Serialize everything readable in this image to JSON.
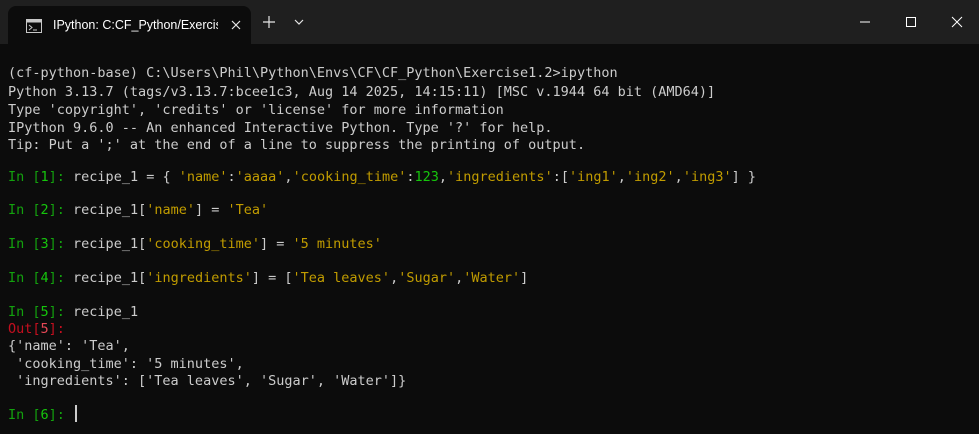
{
  "window": {
    "tab_title": "IPython: C:CF_Python/Exercise",
    "tab_icon": "terminal-icon",
    "controls": [
      "minimize",
      "maximize",
      "close"
    ]
  },
  "terminal": {
    "banner": [
      "(cf-python-base) C:\\Users\\Phil\\Python\\Envs\\CF\\CF_Python\\Exercise1.2>ipython",
      "Python 3.13.7 (tags/v3.13.7:bcee1c3, Aug 14 2025, 14:15:11) [MSC v.1944 64 bit (AMD64)]",
      "Type 'copyright', 'credits' or 'license' for more information",
      "IPython 9.6.0 -- An enhanced Interactive Python. Type '?' for help.",
      "Tip: Put a ';' at the end of a line to suppress the printing of output."
    ],
    "in1": {
      "prompt_in": "In [",
      "num": "1",
      "prompt_close": "]:",
      "code": {
        "a": " recipe_1 = { ",
        "b": "'name'",
        "c": ":",
        "d": "'aaaa'",
        "e": ",",
        "f": "'cooking_time'",
        "g": ":",
        "h": "123",
        "i": ",",
        "j": "'ingredients'",
        "k": ":[",
        "l": "'ing1'",
        "m": ",",
        "n": "'ing2'",
        "o": ",",
        "p": "'ing3'",
        "q": "] }"
      }
    },
    "in2": {
      "prompt_in": "In [",
      "num": "2",
      "prompt_close": "]:",
      "code": {
        "a": " recipe_1[",
        "b": "'name'",
        "c": "] = ",
        "d": "'Tea'"
      }
    },
    "in3": {
      "prompt_in": "In [",
      "num": "3",
      "prompt_close": "]:",
      "code": {
        "a": " recipe_1[",
        "b": "'cooking_time'",
        "c": "] = ",
        "d": "'5 minutes'"
      }
    },
    "in4": {
      "prompt_in": "In [",
      "num": "4",
      "prompt_close": "]:",
      "code": {
        "a": " recipe_1[",
        "b": "'ingredients'",
        "c": "] = [",
        "d": "'Tea leaves'",
        "e": ",",
        "f": "'Sugar'",
        "g": ",",
        "h": "'Water'",
        "i": "]"
      }
    },
    "in5": {
      "prompt_in": "In [",
      "num": "5",
      "prompt_close": "]:",
      "code": {
        "a": " recipe_1"
      }
    },
    "out5": {
      "prompt_out": "Out[",
      "num": "5",
      "prompt_close": "]:"
    },
    "output_lines": [
      "{'name': 'Tea',",
      " 'cooking_time': '5 minutes',",
      " 'ingredients': ['Tea leaves', 'Sugar', 'Water']}"
    ],
    "in6": {
      "prompt_in": "In [",
      "num": "6",
      "prompt_close": "]:",
      "code": {
        "a": " "
      }
    }
  }
}
